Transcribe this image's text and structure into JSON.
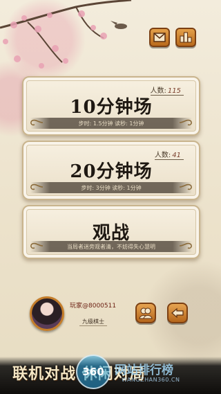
{
  "header": {
    "mail_icon": "mail-icon",
    "rank_icon": "leaderboard-icon"
  },
  "rooms": [
    {
      "count_label": "人数:",
      "count_value": "115",
      "title": "10分钟场",
      "info": "步时: 1.5分钟   读秒: 1分钟"
    },
    {
      "count_label": "人数:",
      "count_value": "41",
      "title": "20分钟场",
      "info": "步时: 3分钟   读秒: 1分钟"
    },
    {
      "title": "观战",
      "info": "当局者迷旁观者清，不妨得失心慧明"
    }
  ],
  "player": {
    "id": "玩家@8000511",
    "rank": "九级棋士"
  },
  "footer": {
    "friends_icon": "friends-icon",
    "back_icon": "back-arrow-icon"
  },
  "banner": {
    "text": "联机对战  休闲对局",
    "watermark_badge": "360",
    "watermark_text": "网站排行榜",
    "watermark_url": "WANGZHAN360.CN"
  }
}
